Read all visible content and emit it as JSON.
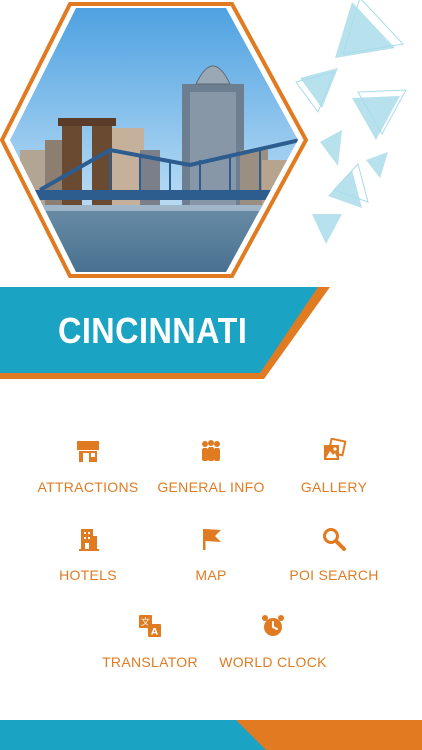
{
  "city": {
    "title": "CINCINNATI"
  },
  "hero": {
    "image": "city-skyline-with-bridge-photo"
  },
  "menu": {
    "items": [
      {
        "label": "ATTRACTIONS",
        "icon": "storefront-icon"
      },
      {
        "label": "GENERAL INFO",
        "icon": "people-group-icon"
      },
      {
        "label": "GALLERY",
        "icon": "photo-gallery-icon"
      },
      {
        "label": "HOTELS",
        "icon": "hotel-building-icon"
      },
      {
        "label": "MAP",
        "icon": "flag-icon"
      },
      {
        "label": "POI SEARCH",
        "icon": "search-icon"
      },
      {
        "label": "TRANSLATOR",
        "icon": "translate-icon"
      },
      {
        "label": "WORLD CLOCK",
        "icon": "alarm-clock-icon"
      }
    ]
  },
  "colors": {
    "accent_orange": "#e07b22",
    "accent_teal": "#1aa3c2",
    "triangle_light": "#a9dcea"
  }
}
